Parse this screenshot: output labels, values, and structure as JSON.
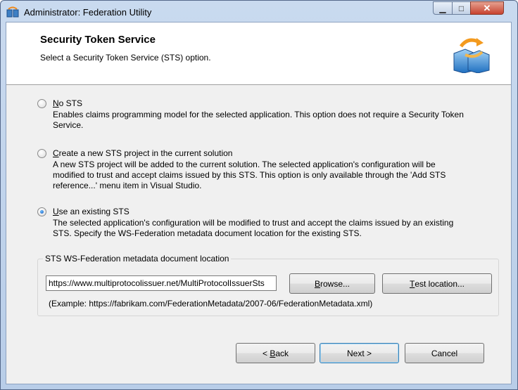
{
  "window": {
    "title": "Administrator: Federation Utility"
  },
  "header": {
    "title": "Security Token Service",
    "subtitle": "Select a Security Token Service (STS) option."
  },
  "options": [
    {
      "label": "No STS",
      "accel": "N",
      "rest": "o STS",
      "description": "Enables claims programming model for the selected application. This option does not require a Security Token Service.",
      "selected": false
    },
    {
      "label": "Create a new STS project in the current solution",
      "accel": "C",
      "rest": "reate a new STS project in the current solution",
      "description": "A new STS project will be added to the current solution. The selected application's configuration will be modified to trust and accept claims issued by this STS. This option is only available through the 'Add STS reference...' menu item in Visual Studio.",
      "selected": false
    },
    {
      "label": "Use an existing STS",
      "accel": "U",
      "rest": "se an existing STS",
      "description": "The selected application's configuration will be modified to trust and accept the claims issued by an existing STS. Specify the WS-Federation metadata document location for the existing STS.",
      "selected": true
    }
  ],
  "metadata": {
    "group_label": "STS WS-Federation metadata document location",
    "url_value": "https://www.multiprotocolissuer.net/MultiProtocolIssuerSts",
    "browse": {
      "accel": "B",
      "rest": "rowse..."
    },
    "test": {
      "accel": "T",
      "rest": "est location..."
    },
    "example": "(Example: https://fabrikam.com/FederationMetadata/2007-06/FederationMetadata.xml)"
  },
  "footer": {
    "back": {
      "prefix": "< ",
      "accel": "B",
      "rest": "ack"
    },
    "next": "Next >",
    "cancel": "Cancel"
  },
  "icons": {
    "app": "federation-app-icon",
    "header": "sts-sync-icon",
    "minimize": "minimize-icon",
    "maximize": "maximize-icon",
    "close": "close-icon"
  }
}
